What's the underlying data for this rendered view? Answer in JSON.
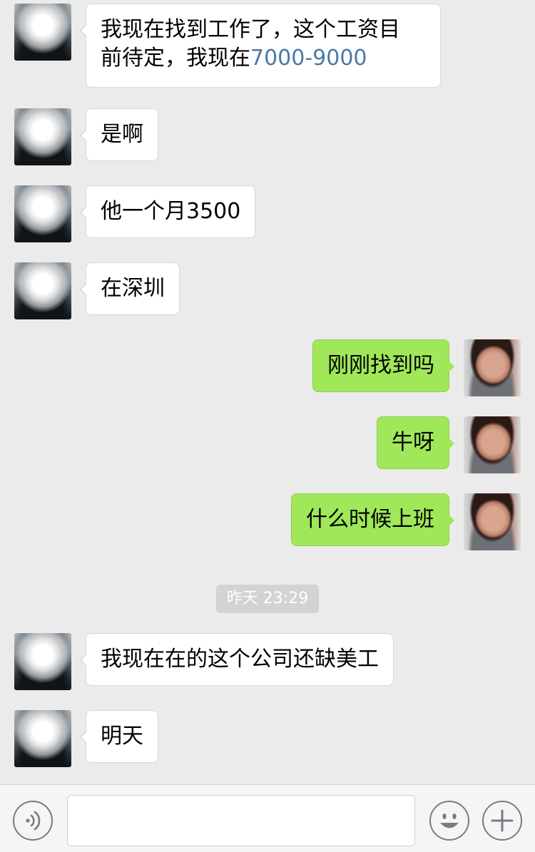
{
  "messages": [
    {
      "line1": "我现在找到工作了，这个工资目",
      "line2_prefix": "前待定，我现在",
      "line2_link": "7000-9000"
    },
    {
      "text": "是啊"
    },
    {
      "text": "他一个月3500"
    },
    {
      "text": "在深圳"
    },
    {
      "text": "刚刚找到吗"
    },
    {
      "text": "牛呀"
    },
    {
      "text": "什么时候上班"
    },
    {
      "text": "我现在在的这个公司还缺美工"
    },
    {
      "text": "明天"
    }
  ],
  "timestamp": "昨天 23:29",
  "input": {
    "value": "",
    "placeholder": ""
  },
  "icons": {
    "voice": "voice-icon",
    "emoji": "emoji-icon",
    "plus": "plus-icon"
  },
  "colors": {
    "background": "#ebebeb",
    "self_bubble": "#a0e75a",
    "other_bubble": "#ffffff",
    "link": "#4a79a8"
  }
}
